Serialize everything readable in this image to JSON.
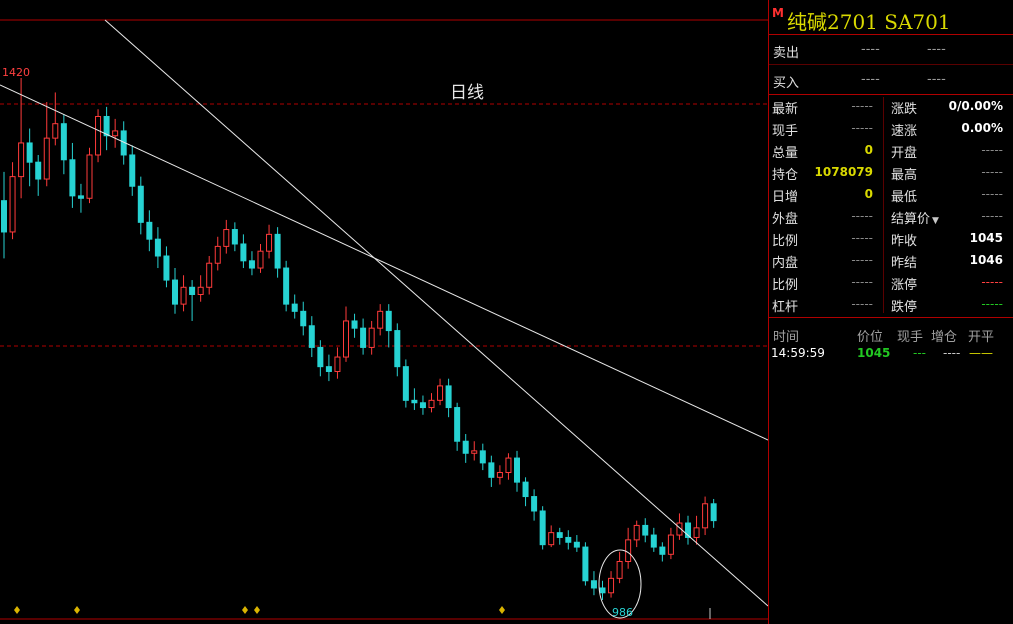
{
  "chart": {
    "period_label": "日线",
    "high_label": "1420",
    "low_label": "986",
    "colors": {
      "up": "#ff3b3b",
      "down": "#27d3d3",
      "trendline": "#e8e8e8",
      "grid": "#b00000"
    }
  },
  "chart_data": {
    "type": "candlestick",
    "title": "日线",
    "ylim": [
      960,
      1440
    ],
    "annotations": {
      "period_high": 1420,
      "period_low": 986
    },
    "candles": [
      [
        1318,
        1292,
        1342,
        1270
      ],
      [
        1292,
        1338,
        1350,
        1286
      ],
      [
        1338,
        1366,
        1420,
        1320
      ],
      [
        1366,
        1350,
        1378,
        1330
      ],
      [
        1350,
        1336,
        1356,
        1322
      ],
      [
        1336,
        1370,
        1400,
        1330
      ],
      [
        1370,
        1382,
        1408,
        1364
      ],
      [
        1382,
        1352,
        1390,
        1340
      ],
      [
        1352,
        1322,
        1366,
        1312
      ],
      [
        1322,
        1320,
        1332,
        1308
      ],
      [
        1320,
        1356,
        1362,
        1316
      ],
      [
        1356,
        1388,
        1394,
        1350
      ],
      [
        1388,
        1372,
        1396,
        1360
      ],
      [
        1372,
        1376,
        1386,
        1362
      ],
      [
        1376,
        1356,
        1384,
        1348
      ],
      [
        1356,
        1330,
        1364,
        1322
      ],
      [
        1330,
        1300,
        1338,
        1290
      ],
      [
        1300,
        1286,
        1310,
        1276
      ],
      [
        1286,
        1272,
        1296,
        1262
      ],
      [
        1272,
        1252,
        1280,
        1246
      ],
      [
        1252,
        1232,
        1262,
        1224
      ],
      [
        1232,
        1246,
        1256,
        1226
      ],
      [
        1246,
        1240,
        1252,
        1218
      ],
      [
        1240,
        1246,
        1256,
        1234
      ],
      [
        1246,
        1266,
        1272,
        1240
      ],
      [
        1266,
        1280,
        1288,
        1260
      ],
      [
        1280,
        1294,
        1302,
        1274
      ],
      [
        1294,
        1282,
        1300,
        1276
      ],
      [
        1282,
        1268,
        1290,
        1262
      ],
      [
        1268,
        1262,
        1276,
        1256
      ],
      [
        1262,
        1276,
        1282,
        1258
      ],
      [
        1276,
        1290,
        1298,
        1270
      ],
      [
        1290,
        1262,
        1296,
        1254
      ],
      [
        1262,
        1232,
        1268,
        1226
      ],
      [
        1232,
        1226,
        1240,
        1220
      ],
      [
        1226,
        1214,
        1234,
        1206
      ],
      [
        1214,
        1196,
        1222,
        1188
      ],
      [
        1196,
        1180,
        1202,
        1172
      ],
      [
        1180,
        1176,
        1190,
        1168
      ],
      [
        1176,
        1188,
        1196,
        1170
      ],
      [
        1188,
        1218,
        1230,
        1184
      ],
      [
        1218,
        1212,
        1224,
        1204
      ],
      [
        1212,
        1196,
        1220,
        1190
      ],
      [
        1196,
        1212,
        1218,
        1190
      ],
      [
        1212,
        1226,
        1232,
        1206
      ],
      [
        1226,
        1210,
        1232,
        1196
      ],
      [
        1210,
        1180,
        1216,
        1172
      ],
      [
        1180,
        1152,
        1186,
        1146
      ],
      [
        1152,
        1150,
        1162,
        1144
      ],
      [
        1150,
        1146,
        1156,
        1140
      ],
      [
        1146,
        1152,
        1158,
        1142
      ],
      [
        1152,
        1164,
        1170,
        1148
      ],
      [
        1164,
        1146,
        1170,
        1138
      ],
      [
        1146,
        1118,
        1150,
        1110
      ],
      [
        1118,
        1108,
        1124,
        1100
      ],
      [
        1108,
        1110,
        1118,
        1102
      ],
      [
        1110,
        1100,
        1116,
        1094
      ],
      [
        1100,
        1088,
        1106,
        1080
      ],
      [
        1088,
        1092,
        1098,
        1082
      ],
      [
        1092,
        1104,
        1108,
        1086
      ],
      [
        1104,
        1084,
        1110,
        1076
      ],
      [
        1084,
        1072,
        1088,
        1064
      ],
      [
        1072,
        1060,
        1078,
        1052
      ],
      [
        1060,
        1032,
        1064,
        1028
      ],
      [
        1032,
        1042,
        1048,
        1030
      ],
      [
        1042,
        1038,
        1046,
        1032
      ],
      [
        1038,
        1034,
        1044,
        1028
      ],
      [
        1034,
        1030,
        1040,
        1026
      ],
      [
        1030,
        1002,
        1034,
        998
      ],
      [
        1002,
        996,
        1010,
        990
      ],
      [
        996,
        992,
        1002,
        986
      ],
      [
        992,
        1004,
        1010,
        988
      ],
      [
        1004,
        1018,
        1026,
        1000
      ],
      [
        1018,
        1036,
        1046,
        1012
      ],
      [
        1036,
        1048,
        1052,
        1030
      ],
      [
        1048,
        1040,
        1054,
        1034
      ],
      [
        1040,
        1030,
        1046,
        1026
      ],
      [
        1030,
        1024,
        1034,
        1018
      ],
      [
        1024,
        1040,
        1046,
        1020
      ],
      [
        1040,
        1050,
        1058,
        1036
      ],
      [
        1050,
        1038,
        1056,
        1032
      ],
      [
        1038,
        1046,
        1056,
        1032
      ],
      [
        1046,
        1066,
        1072,
        1040
      ],
      [
        1066,
        1052,
        1070,
        1046
      ]
    ],
    "trendlines": [
      {
        "from_bar": 0,
        "from_price": 1410,
        "to_bar": 85,
        "to_price": 1112
      },
      {
        "from_bar": 12,
        "from_price": 1440,
        "to_bar": 85,
        "to_price": 984
      }
    ]
  },
  "quote": {
    "badge": "M",
    "title": "纯碱2701  SA701",
    "orderbook": [
      {
        "label": "卖出",
        "price": "----",
        "volume": "----"
      },
      {
        "label": "买入",
        "price": "----",
        "volume": "----"
      }
    ],
    "stats": [
      {
        "l1": "最新",
        "v1": "-----",
        "c1": "dash",
        "l2": "涨跌",
        "v2": "0/0.00%",
        "c2": "white"
      },
      {
        "l1": "现手",
        "v1": "-----",
        "c1": "dash",
        "l2": "速涨",
        "v2": "0.00%",
        "c2": "white"
      },
      {
        "l1": "总量",
        "v1": "0",
        "c1": "yellow",
        "l2": "开盘",
        "v2": "-----",
        "c2": "dash"
      },
      {
        "l1": "持仓",
        "v1": "1078079",
        "c1": "yellow",
        "l2": "最高",
        "v2": "-----",
        "c2": "dash"
      },
      {
        "l1": "日增",
        "v1": "0",
        "c1": "yellow",
        "l2": "最低",
        "v2": "-----",
        "c2": "dash"
      },
      {
        "l1": "外盘",
        "v1": "-----",
        "c1": "dash",
        "l2": "结算价",
        "v2": "-----",
        "c2": "dash",
        "dropdown": true
      },
      {
        "l1": "比例",
        "v1": "-----",
        "c1": "dash",
        "l2": "昨收",
        "v2": "1045",
        "c2": "white"
      },
      {
        "l1": "内盘",
        "v1": "-----",
        "c1": "dash",
        "l2": "昨结",
        "v2": "1046",
        "c2": "white"
      },
      {
        "l1": "比例",
        "v1": "-----",
        "c1": "dash",
        "l2": "涨停",
        "v2": "-----",
        "c2": "red"
      },
      {
        "l1": "杠杆",
        "v1": "-----",
        "c1": "dash",
        "l2": "跌停",
        "v2": "-----",
        "c2": "green"
      }
    ],
    "ticks_header": {
      "time": "时间",
      "price": "价位",
      "volume": "现手",
      "oi_change": "增仓",
      "open_close": "开平"
    },
    "ticks": [
      {
        "time": "14:59:59",
        "price": "1045",
        "volume": "---",
        "oi_change": "----",
        "open_close": "——"
      }
    ]
  }
}
